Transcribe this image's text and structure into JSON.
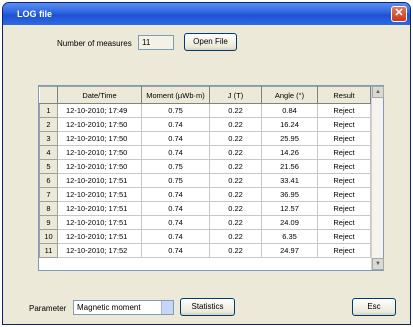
{
  "window": {
    "title": "LOG file",
    "close_glyph": "✕"
  },
  "measures": {
    "label": "Number of measures",
    "value": "11"
  },
  "buttons": {
    "open_file": "Open File",
    "statistics": "Statistics",
    "esc": "Esc"
  },
  "table": {
    "headers": [
      "",
      "Date/Time",
      "Moment (µWb·m)",
      "J (T)",
      "Angle (°)",
      "Result"
    ],
    "rows": [
      [
        "1",
        "12-10-2010; 17:49",
        "0.75",
        "0.22",
        "0.84",
        "Reject"
      ],
      [
        "2",
        "12-10-2010; 17:50",
        "0.74",
        "0.22",
        "16.24",
        "Reject"
      ],
      [
        "3",
        "12-10-2010; 17:50",
        "0.74",
        "0.22",
        "25.95",
        "Reject"
      ],
      [
        "4",
        "12-10-2010; 17:50",
        "0.74",
        "0.22",
        "14.26",
        "Reject"
      ],
      [
        "5",
        "12-10-2010; 17:50",
        "0.75",
        "0.22",
        "21.56",
        "Reject"
      ],
      [
        "6",
        "12-10-2010; 17:51",
        "0.75",
        "0.22",
        "33.41",
        "Reject"
      ],
      [
        "7",
        "12-10-2010; 17:51",
        "0.74",
        "0.22",
        "36.95",
        "Reject"
      ],
      [
        "8",
        "12-10-2010; 17:51",
        "0.74",
        "0.22",
        "12.57",
        "Reject"
      ],
      [
        "9",
        "12-10-2010; 17:51",
        "0.74",
        "0.22",
        "24.09",
        "Reject"
      ],
      [
        "10",
        "12-10-2010; 17:51",
        "0.74",
        "0.22",
        "6.35",
        "Reject"
      ],
      [
        "11",
        "12-10-2010; 17:52",
        "0.74",
        "0.22",
        "24.97",
        "Reject"
      ]
    ]
  },
  "parameter": {
    "label": "Parameter",
    "selected": "Magnetic moment"
  },
  "scrollbar": {
    "up_glyph": "▲",
    "down_glyph": "▼"
  }
}
